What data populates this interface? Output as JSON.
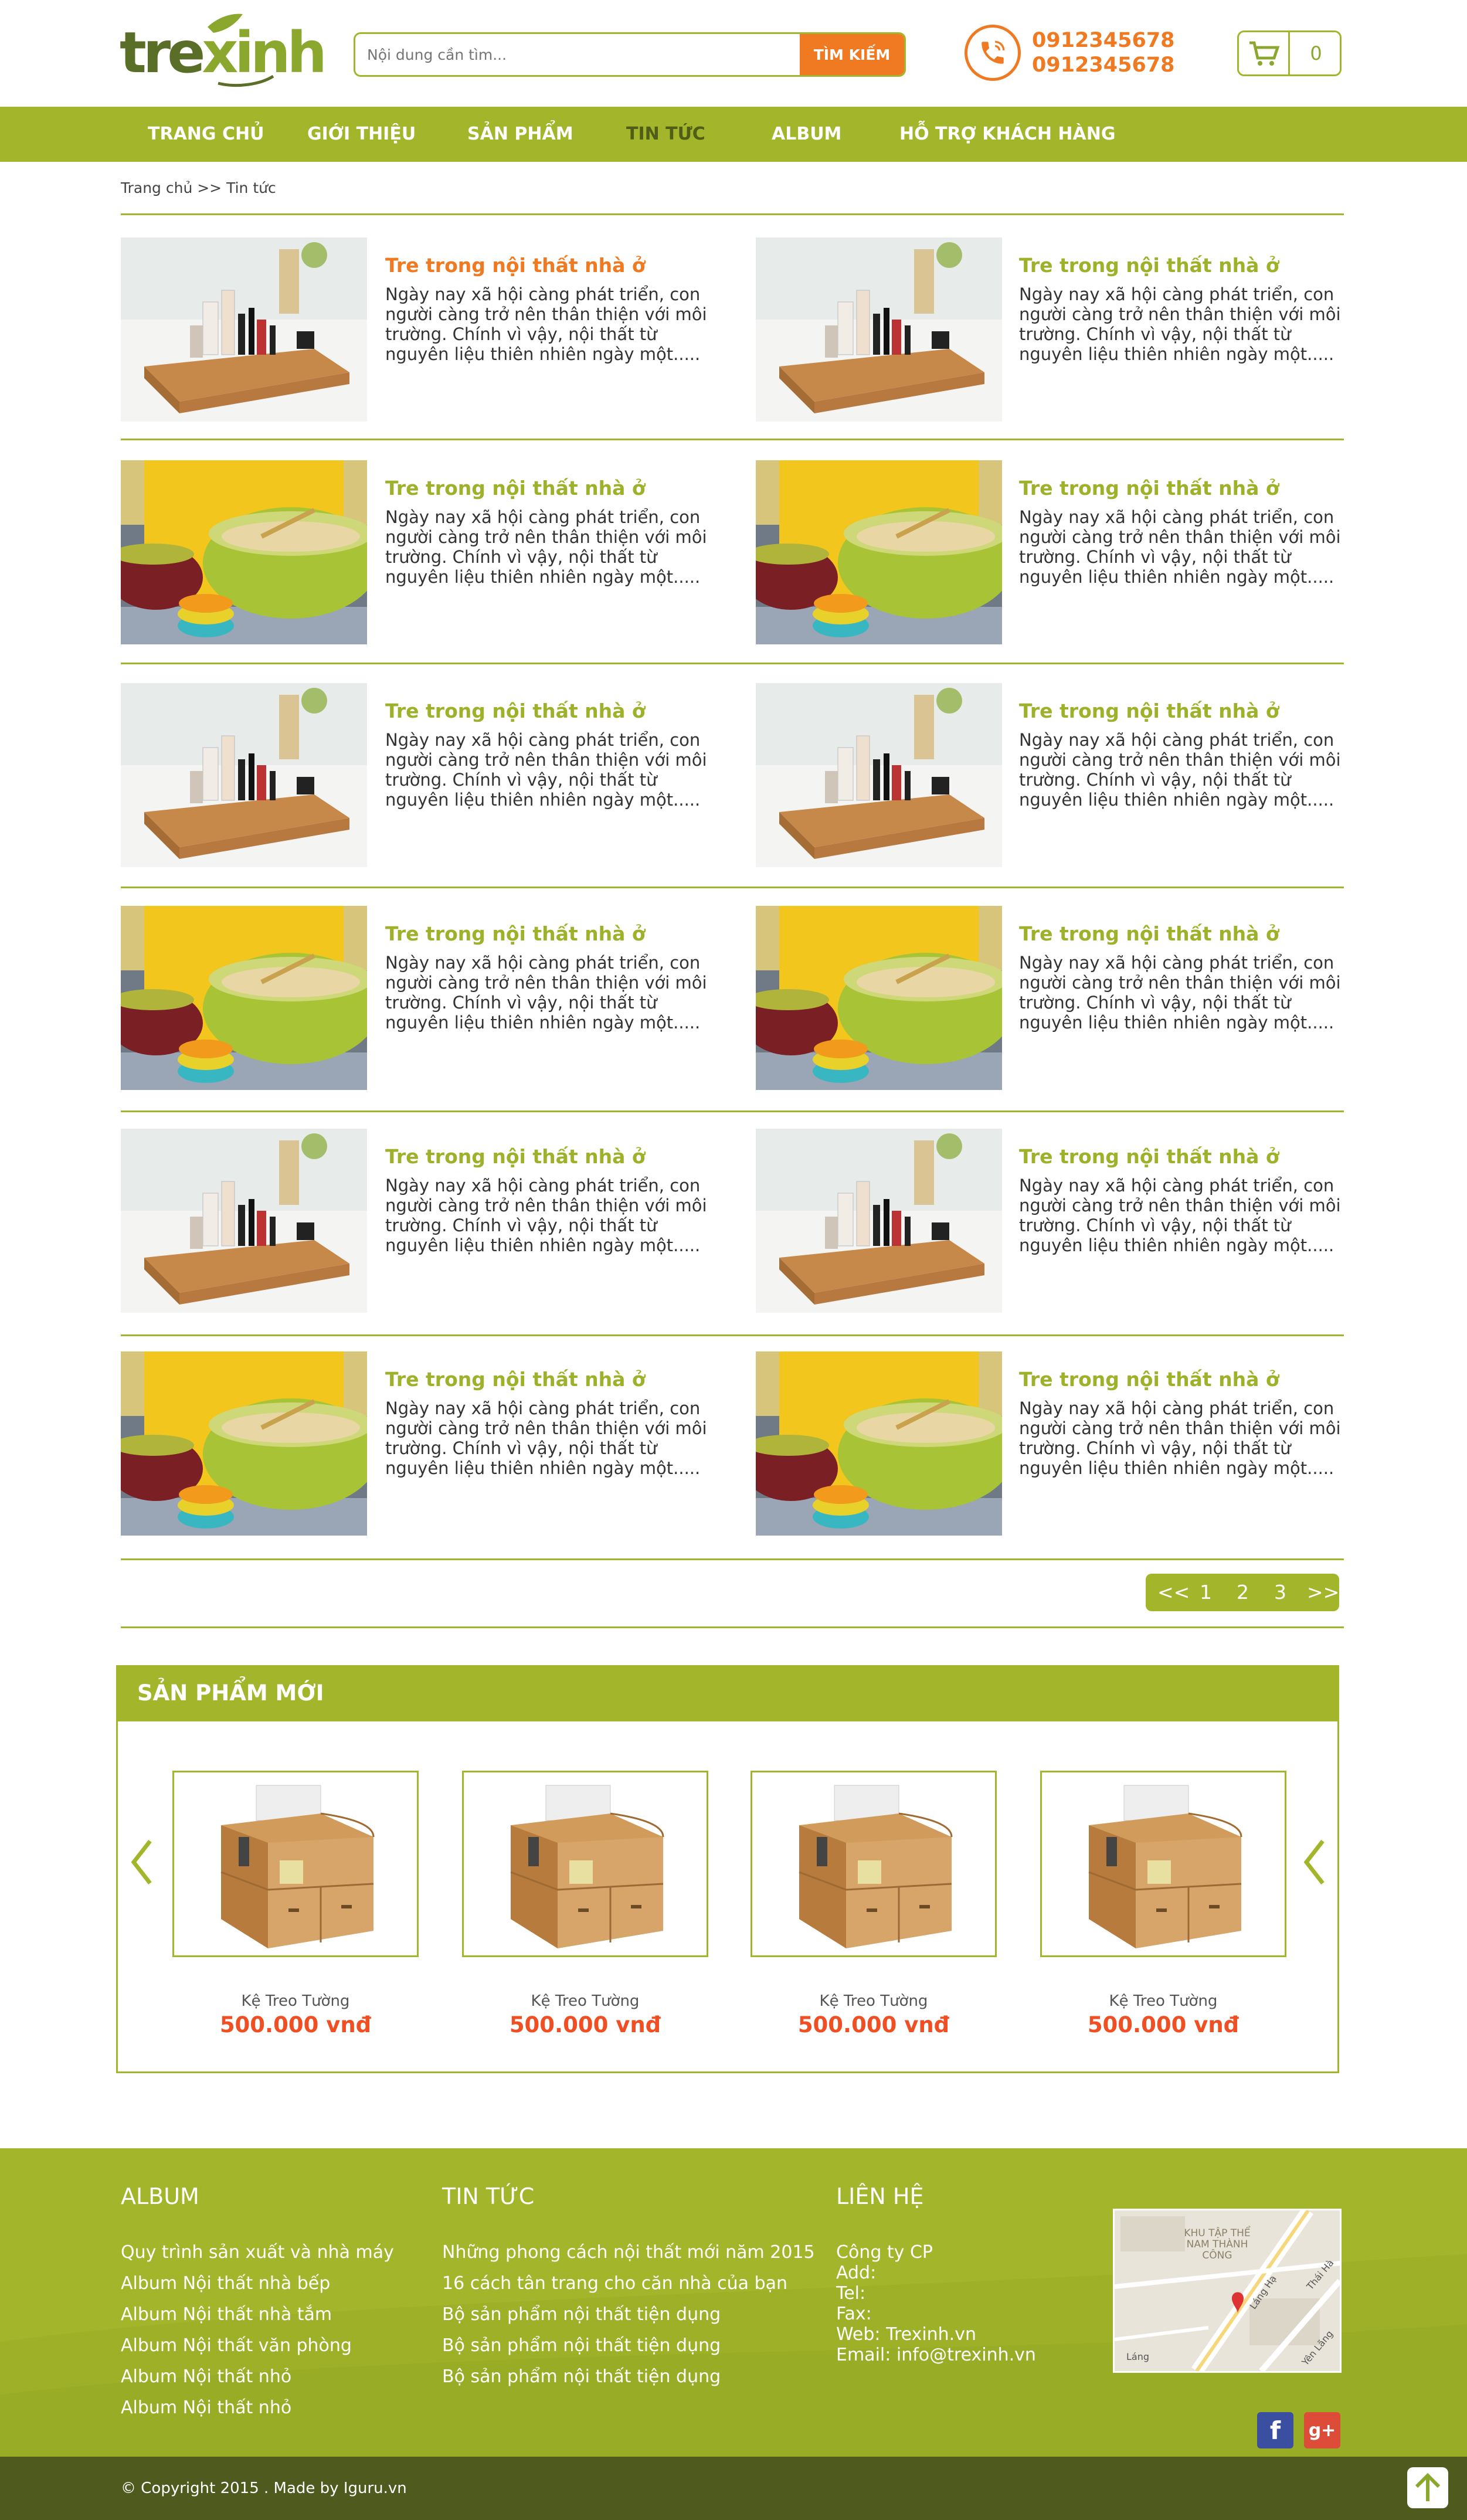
{
  "header": {
    "logo_text_a": "tre",
    "logo_text_b": "xinh",
    "search_placeholder": "Nội dung cần tìm...",
    "search_button": "TÌM KIẾM",
    "phone_1": "0912345678",
    "phone_2": "0912345678",
    "cart_count": "0"
  },
  "nav": {
    "items": [
      "TRANG CHỦ",
      "GIỚI THIỆU",
      "SẢN PHẨM",
      "TIN TỨC",
      "ALBUM",
      "HỖ TRỢ KHÁCH HÀNG"
    ],
    "active_index": 3
  },
  "breadcrumb": "Trang chủ >> Tin tức",
  "articles": {
    "title": "Tre trong nội thất nhà ở",
    "text": "Ngày nay xã hội càng phát triển, con người càng trở nên thân thiện với môi trường. Chính vì vậy, nội thất từ nguyên liệu thiên nhiên ngày một.....",
    "rows": [
      [
        "cosmetic-tray",
        "cosmetic-tray"
      ],
      [
        "bowls-yellow",
        "bowls-yellow"
      ],
      [
        "cosmetic-tray",
        "cosmetic-tray"
      ],
      [
        "bowls-yellow",
        "bowls-yellow"
      ],
      [
        "cosmetic-tray",
        "cosmetic-tray"
      ],
      [
        "bowls-yellow",
        "bowls-yellow"
      ]
    ],
    "first_title_color": "#ef7a21",
    "title_color": "#9fb12a"
  },
  "pagination": {
    "prev": "<<",
    "pages": [
      "1",
      "2",
      "3"
    ],
    "next": ">>"
  },
  "new_products": {
    "heading": "SẢN PHẨM MỚI",
    "items": [
      {
        "name": "Kệ Treo Tường",
        "price": "500.000 vnđ"
      },
      {
        "name": "Kệ Treo Tường",
        "price": "500.000 vnđ"
      },
      {
        "name": "Kệ Treo Tường",
        "price": "500.000 vnđ"
      },
      {
        "name": "Kệ Treo Tường",
        "price": "500.000 vnđ"
      }
    ]
  },
  "footer": {
    "album": {
      "heading": "ALBUM",
      "links": [
        "Quy trình sản xuất và nhà máy",
        "Album Nội thất nhà bếp",
        "Album Nội thất nhà tắm",
        "Album Nội thất văn phòng",
        "Album Nội thất nhỏ",
        "Album Nội thất nhỏ"
      ]
    },
    "news": {
      "heading": "TIN TỨC",
      "links": [
        "Những phong cách nội thất mới năm 2015",
        "16 cách tân trang cho căn nhà của bạn",
        "Bộ sản phẩm nội thất tiện dụng",
        "Bộ sản phẩm nội thất tiện dụng",
        "Bộ sản phẩm nội thất tiện dụng"
      ]
    },
    "contact": {
      "heading": "LIÊN HỆ",
      "lines": [
        "Công ty CP",
        "Add:",
        "Tel:",
        "Fax:",
        "Web: Trexinh.vn",
        "Email: info@trexinh.vn"
      ]
    },
    "map_labels": {
      "area": "KHU TẬP THỂ NAM THÀNH CÔNG",
      "street_1": "Láng Hạ",
      "street_2": "Thái Hà",
      "street_3": "Yên Lãng",
      "street_4": "Láng"
    },
    "copyright": "© Copyright 2015  .  Made by Iguru.vn"
  },
  "colors": {
    "green": "#a3b52a",
    "orange": "#ef7a21",
    "dark_green": "#4f5a1f",
    "price_red": "#ef4f23"
  },
  "icons": [
    "phone-icon",
    "cart-icon",
    "facebook-icon",
    "google-plus-icon",
    "back-to-top-icon",
    "carousel-left-arrow-icon",
    "carousel-right-arrow-icon"
  ]
}
